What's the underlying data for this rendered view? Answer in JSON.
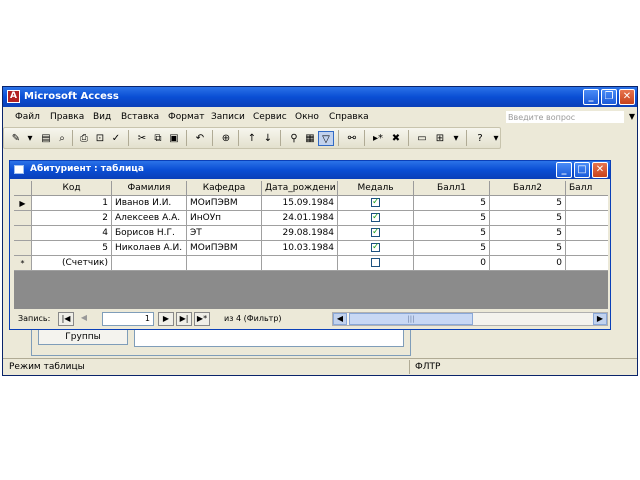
{
  "window": {
    "title": "Microsoft Access",
    "icon": "access-icon"
  },
  "menu": [
    "Файл",
    "Правка",
    "Вид",
    "Вставка",
    "Формат",
    "Записи",
    "Сервис",
    "Окно",
    "Справка"
  ],
  "ask_placeholder": "Введите вопрос",
  "child": {
    "title": "Абитуриент : таблица"
  },
  "columns": [
    "Код",
    "Фамилия",
    "Кафедра",
    "Дата_рождени",
    "Медаль",
    "Балл1",
    "Балл2",
    "Балл"
  ],
  "rows": [
    {
      "marker": "▶",
      "code": "1",
      "name": "Иванов И.И.",
      "dept": "МОиПЭВМ",
      "birth": "15.09.1984",
      "medal": true,
      "s1": "5",
      "s2": "5"
    },
    {
      "marker": "",
      "code": "2",
      "name": "Алексеев А.А.",
      "dept": "ИнОУп",
      "birth": "24.01.1984",
      "medal": true,
      "s1": "5",
      "s2": "5"
    },
    {
      "marker": "",
      "code": "4",
      "name": "Борисов Н.Г.",
      "dept": "ЭТ",
      "birth": "29.08.1984",
      "medal": true,
      "s1": "5",
      "s2": "5"
    },
    {
      "marker": "",
      "code": "5",
      "name": "Николаев А.И.",
      "dept": "МОиПЭВМ",
      "birth": "10.03.1984",
      "medal": true,
      "s1": "5",
      "s2": "5"
    }
  ],
  "new_row": {
    "marker": "*",
    "code": "(Счетчик)",
    "medal": false,
    "s1": "0",
    "s2": "0"
  },
  "nav": {
    "label": "Запись:",
    "current": "1",
    "info": "из 4 (Фильтр)"
  },
  "bg_form": {
    "button": "Группы"
  },
  "status": {
    "mode": "Режим таблицы",
    "filter": "ФЛТР"
  }
}
